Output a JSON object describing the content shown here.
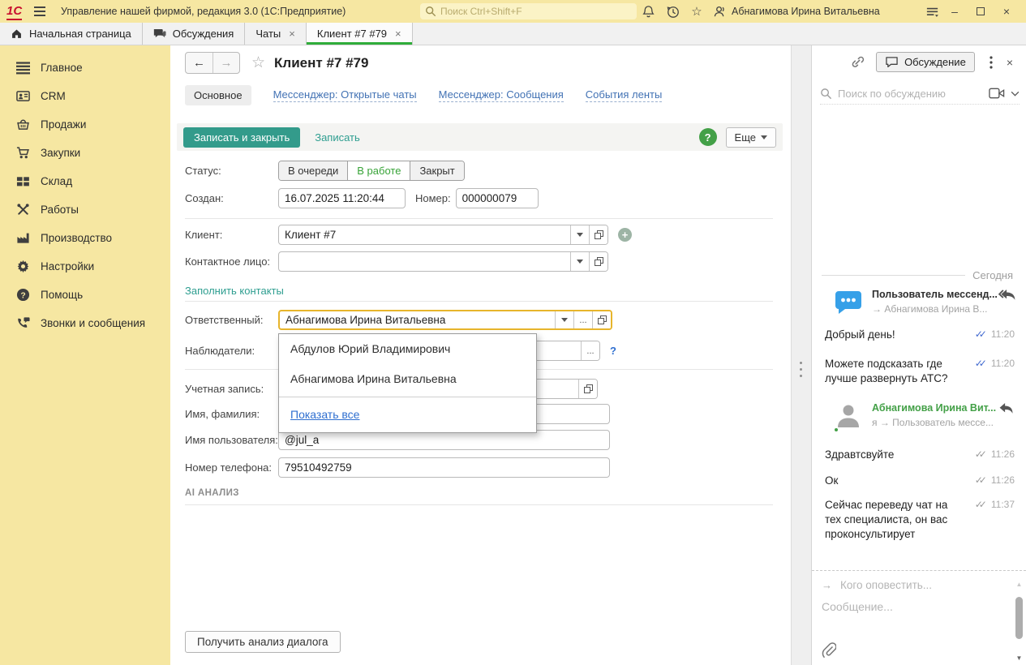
{
  "colors": {
    "brand_yellow": "#f6e7a2",
    "accent_teal": "#339b8b",
    "active_tab_green": "#2fad3a",
    "status_active_green": "#37a337",
    "nav_link_blue": "#4272b4",
    "dropdown_link_blue": "#2f6fd0",
    "focus_gold": "#e7b52c",
    "avatar_blue": "#36a0e8",
    "online_green": "#43a047",
    "read_check_blue": "#4169cf"
  },
  "icons": {
    "logo": "1С",
    "back": "←",
    "forward": "→",
    "favorite_star": "☆",
    "titlebar_star": "☆",
    "ellipsis": "...",
    "close": "×",
    "minimize": "–",
    "help": "?",
    "plus": "+",
    "watchers_help": "?",
    "double_check": "✓✓",
    "notify_arrow": "→",
    "scroll_up": "▲",
    "scroll_down": "▼"
  },
  "titlebar": {
    "app_title": "Управление нашей фирмой, редакция 3.0  (1С:Предприятие)",
    "search_placeholder": "Поиск Ctrl+Shift+F",
    "user_name": "Абнагимова Ирина Витальевна"
  },
  "tabbar": {
    "tabs": [
      {
        "label": "Начальная страница",
        "icon": "home-icon"
      },
      {
        "label": "Обсуждения",
        "icon": "chat-icon"
      },
      {
        "label": "Чаты",
        "closable": true
      },
      {
        "label": "Клиент #7 #79",
        "closable": true,
        "active": true
      }
    ]
  },
  "sidebar": {
    "items": [
      {
        "label": "Главное",
        "icon": "main-menu-icon"
      },
      {
        "label": "CRM",
        "icon": "crm-icon"
      },
      {
        "label": "Продажи",
        "icon": "sales-icon"
      },
      {
        "label": "Закупки",
        "icon": "purchases-icon"
      },
      {
        "label": "Склад",
        "icon": "warehouse-icon"
      },
      {
        "label": "Работы",
        "icon": "works-icon"
      },
      {
        "label": "Производство",
        "icon": "production-icon"
      },
      {
        "label": "Настройки",
        "icon": "settings-icon"
      },
      {
        "label": "Помощь",
        "icon": "help-icon"
      },
      {
        "label": "Звонки и сообщения",
        "icon": "calls-icon"
      }
    ]
  },
  "form": {
    "title": "Клиент #7 #79",
    "nav": {
      "active": "Основное",
      "links": [
        "Мессенджер: Открытые чаты",
        "Мессенджер: Сообщения",
        "События ленты"
      ]
    },
    "commands": {
      "save_close": "Записать и закрыть",
      "save": "Записать",
      "more": "Еще"
    },
    "status": {
      "label": "Статус:",
      "options": [
        "В очереди",
        "В работе",
        "Закрыт"
      ],
      "selected": "В работе"
    },
    "created": {
      "label": "Создан:",
      "value": "16.07.2025 11:20:44"
    },
    "number": {
      "label": "Номер:",
      "value": "000000079"
    },
    "client": {
      "label": "Клиент:",
      "value": "Клиент #7"
    },
    "contact": {
      "label": "Контактное лицо:",
      "value": ""
    },
    "fill_contacts_link": "Заполнить контакты",
    "responsible": {
      "label": "Ответственный:",
      "value": "Абнагимова Ирина Витальевна"
    },
    "watchers": {
      "label": "Наблюдатели:",
      "value": ""
    },
    "account": {
      "label": "Учетная запись:",
      "value": ""
    },
    "full_name": {
      "label": "Имя, фамилия:",
      "value": ""
    },
    "username": {
      "label": "Имя пользователя:",
      "value": "@jul_a"
    },
    "phone": {
      "label": "Номер телефона:",
      "value": "79510492759"
    },
    "ai_section": "AI АНАЛИЗ",
    "analyze_button": "Получить анализ диалога"
  },
  "dropdown": {
    "items": [
      "Абдулов Юрий Владимирович",
      "Абнагимова Ирина Витальевна"
    ],
    "show_all": "Показать все"
  },
  "discussion": {
    "panel_button": "Обсуждение",
    "search_placeholder": "Поиск по обсуждению",
    "date_divider": "Сегодня",
    "groups": [
      {
        "author": "Пользователь мессенд...",
        "direction": "→ Абнагимова Ирина В...",
        "messages": [
          {
            "text": "Добрый день!",
            "time": "11:20"
          },
          {
            "text": "Можете подсказать где лучше развернуть АТС?",
            "time": "11:20"
          }
        ]
      },
      {
        "author": "Абнагимова Ирина Вит...",
        "direction": "я → Пользователь мессе...",
        "messages": [
          {
            "text": "Здравтсвуйте",
            "time": "11:26"
          },
          {
            "text": "Ок",
            "time": "11:26"
          },
          {
            "text": "Сейчас переведу чат на тех специалиста, он вас проконсультирует",
            "time": "11:37"
          }
        ]
      }
    ],
    "notify_placeholder": "Кого оповестить...",
    "message_placeholder": "Сообщение..."
  }
}
